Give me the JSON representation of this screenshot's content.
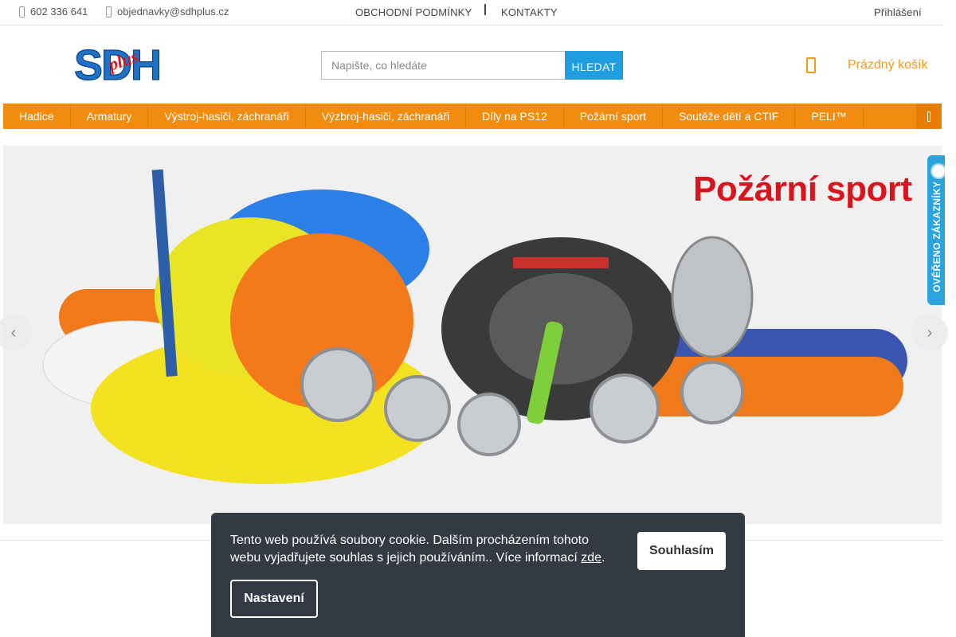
{
  "topbar": {
    "phone": "602 336 641",
    "email": "objednavky@sdhplus.cz",
    "links": [
      "OBCHODNÍ PODMÍNKY",
      "KONTAKTY"
    ],
    "login": "Přihlášení"
  },
  "header": {
    "logo_text": "SDH",
    "logo_sub": "plus",
    "search_placeholder": "Napište, co hledáte",
    "search_button": "HLEDAT",
    "cart_label": "Prázdný košík"
  },
  "nav": {
    "items": [
      "Hadice",
      "Armatury",
      "Výstroj-hasiči, záchranáři",
      "Výzbroj-hasiči, záchranáři",
      "Díly na PS12",
      "Požární sport",
      "Soutěže dětí a CTIF",
      "PELI™"
    ]
  },
  "hero": {
    "title": "Požární sport",
    "prev": "‹",
    "next": "›"
  },
  "badge": {
    "text": "OVĚŘENO ZÁKAZNÍKY"
  },
  "cookie": {
    "message": "Tento web používá soubory cookie. Dalším procházením tohoto webu vyjadřujete souhlas s jejich používáním.. Více informací",
    "link": "zde",
    "period": ".",
    "agree": "Souhlasím",
    "settings": "Nastavení"
  },
  "colors": {
    "nav": "#f28c0f",
    "search_button": "#1e9ee0",
    "cart": "#f39a1a",
    "hero_title": "#d8141c",
    "cookie_bg": "#343a44"
  }
}
